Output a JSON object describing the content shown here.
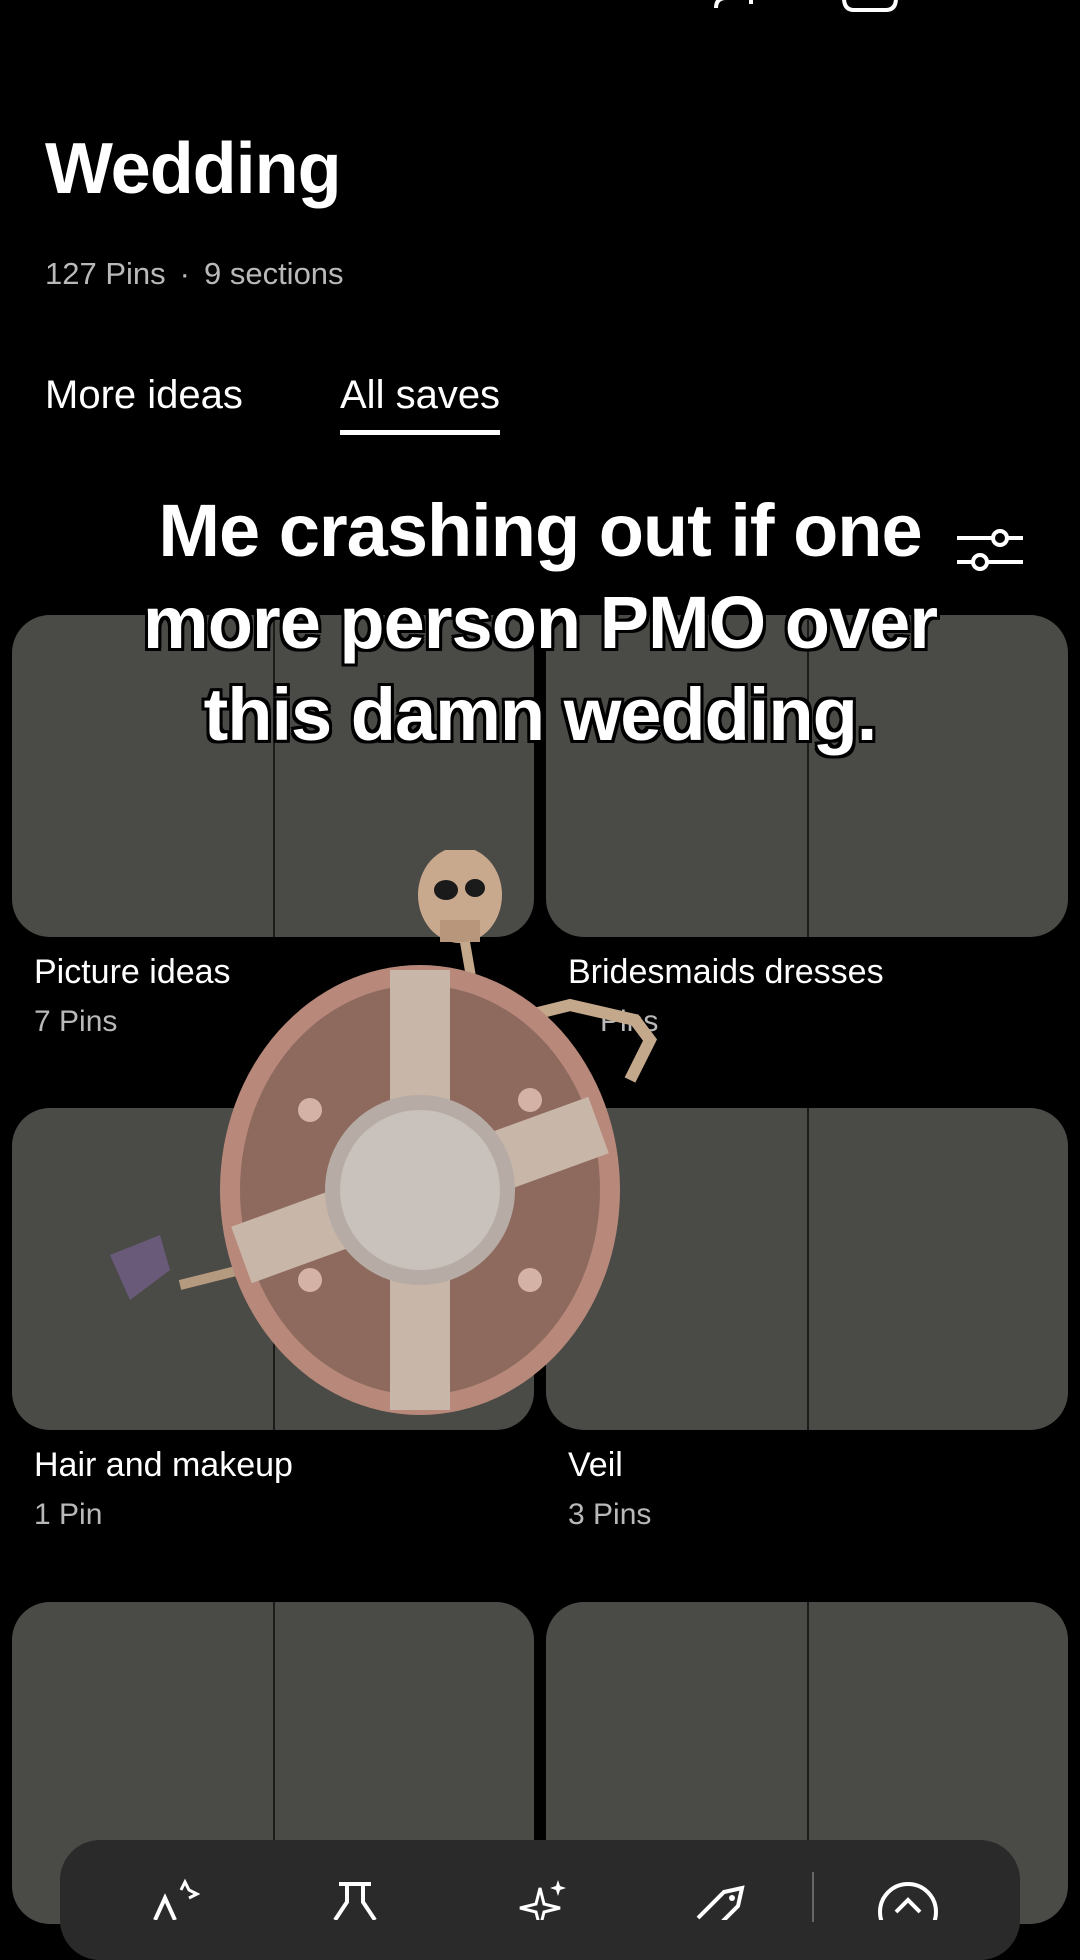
{
  "header": {
    "title": "Wedding",
    "pins_count": "127 Pins",
    "separator": "·",
    "sections_count": "9 sections"
  },
  "tabs": [
    {
      "label": "More ideas",
      "active": false
    },
    {
      "label": "All saves",
      "active": true
    }
  ],
  "sections": [
    {
      "title": "Picture ideas",
      "count": "7 Pins"
    },
    {
      "title": "Bridesmaids dresses",
      "count": "Pins"
    },
    {
      "title": "Hair and makeup",
      "count": "1 Pin"
    },
    {
      "title": "Veil",
      "count": "3 Pins"
    }
  ],
  "overlay": {
    "caption": "Me crashing out if one more person PMO over this damn wedding."
  },
  "icons": {
    "back": "chevron-left-icon",
    "add_collaborator": "add-person-icon",
    "more": "more-options-icon",
    "filter": "filter-sliders-icon",
    "toolbar": [
      "organize-icon",
      "lab-icon",
      "sparkle-icon",
      "tag-icon",
      "upload-icon"
    ]
  },
  "colors": {
    "background": "#000000",
    "card": "#4a4a46",
    "secondary_text": "#b9b9b9",
    "toolbar": "#2a2a2a"
  }
}
